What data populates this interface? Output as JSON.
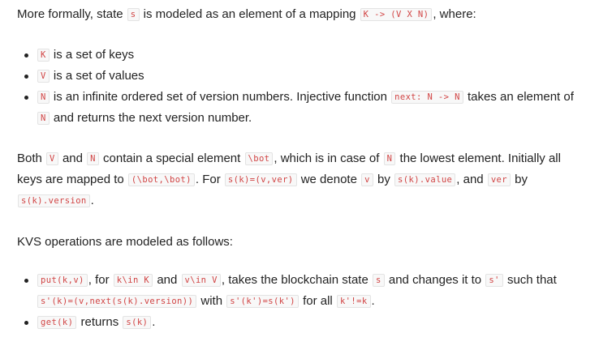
{
  "para1": {
    "t1": "More formally, state",
    "c1": "s",
    "t2": "is modeled as an element of a mapping",
    "c2": "K -> (V X N)",
    "t3": ", where:"
  },
  "list1": [
    {
      "code": "K",
      "text": "is a set of keys"
    },
    {
      "code": "V",
      "text": "is a set of values"
    },
    {
      "code": "N",
      "text1": "is an infinite ordered set of version numbers. Injective function",
      "code2": "next: N -> N",
      "text2": "takes an element of",
      "code3": "N",
      "text3": "and returns the next version number."
    }
  ],
  "para2": {
    "t1": "Both",
    "c1": "V",
    "t2": "and",
    "c2": "N",
    "t3": "contain a special element",
    "c3": "\\bot",
    "t4": ", which is in case of",
    "c4": "N",
    "t5": "the lowest element. Initially all keys are mapped to",
    "c5": "(\\bot,\\bot)",
    "t6": ". For",
    "c6": "s(k)=(v,ver)",
    "t7": "we denote",
    "c7": "v",
    "t8": "by",
    "c8": "s(k).value",
    "t9": ", and",
    "c9": "ver",
    "t10": "by",
    "c10": "s(k).version",
    "t11": "."
  },
  "para3": {
    "text": "KVS operations are modeled as follows:"
  },
  "list2": [
    {
      "c1": "put(k,v)",
      "t1": ", for",
      "c2": "k\\in K",
      "t2": "and",
      "c3": "v\\in V",
      "t3": ", takes the blockchain state",
      "c4": "s",
      "t4": "and changes it to",
      "c5": "s'",
      "t5": "such that",
      "c6": "s'(k)=(v,next(s(k).version))",
      "t6": "with",
      "c7": "s'(k')=s(k')",
      "t7": "for all",
      "c8": "k'!=k",
      "t8": "."
    },
    {
      "c1": "get(k)",
      "t1": "returns",
      "c2": "s(k)",
      "t2": "."
    }
  ]
}
